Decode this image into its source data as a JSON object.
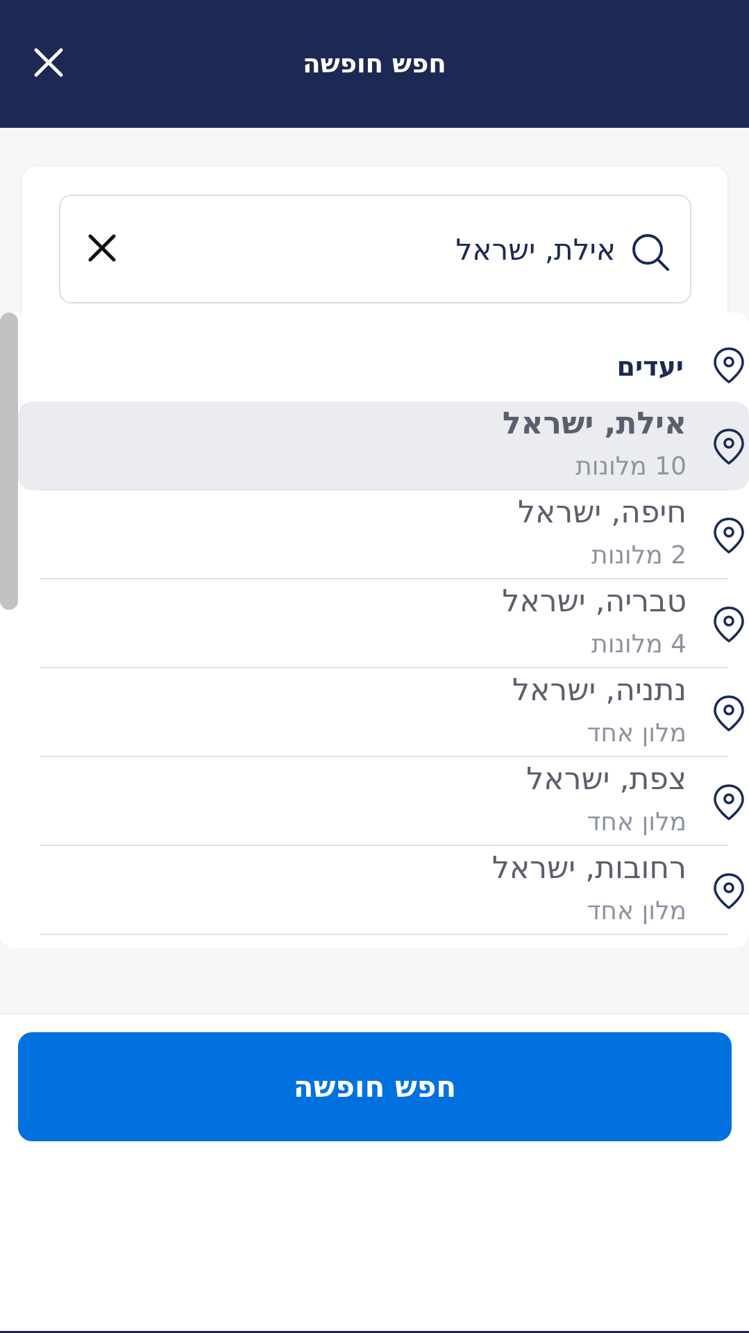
{
  "header": {
    "title": "חפש חופשה"
  },
  "search": {
    "value": "אילת, ישראל"
  },
  "dropdown": {
    "section_title": "יעדים",
    "items": [
      {
        "name": "אילת, ישראל",
        "count": "10 מלונות"
      },
      {
        "name": "חיפה, ישראל",
        "count": "2 מלונות"
      },
      {
        "name": "טבריה, ישראל",
        "count": "4 מלונות"
      },
      {
        "name": "נתניה, ישראל",
        "count": "מלון אחד"
      },
      {
        "name": "צפת, ישראל",
        "count": "מלון אחד"
      },
      {
        "name": "רחובות, ישראל",
        "count": "מלון אחד"
      }
    ],
    "selected_item": "אילת, ישראל"
  },
  "footer": {
    "button_label": "חפש חופשה"
  },
  "colors": {
    "header_bg": "#1c2954",
    "accent": "#0071de",
    "selected_row": "#ebecf0"
  },
  "icons": {
    "close": "close-icon",
    "search": "search-icon",
    "clear": "clear-icon",
    "pin": "map-pin-icon"
  }
}
